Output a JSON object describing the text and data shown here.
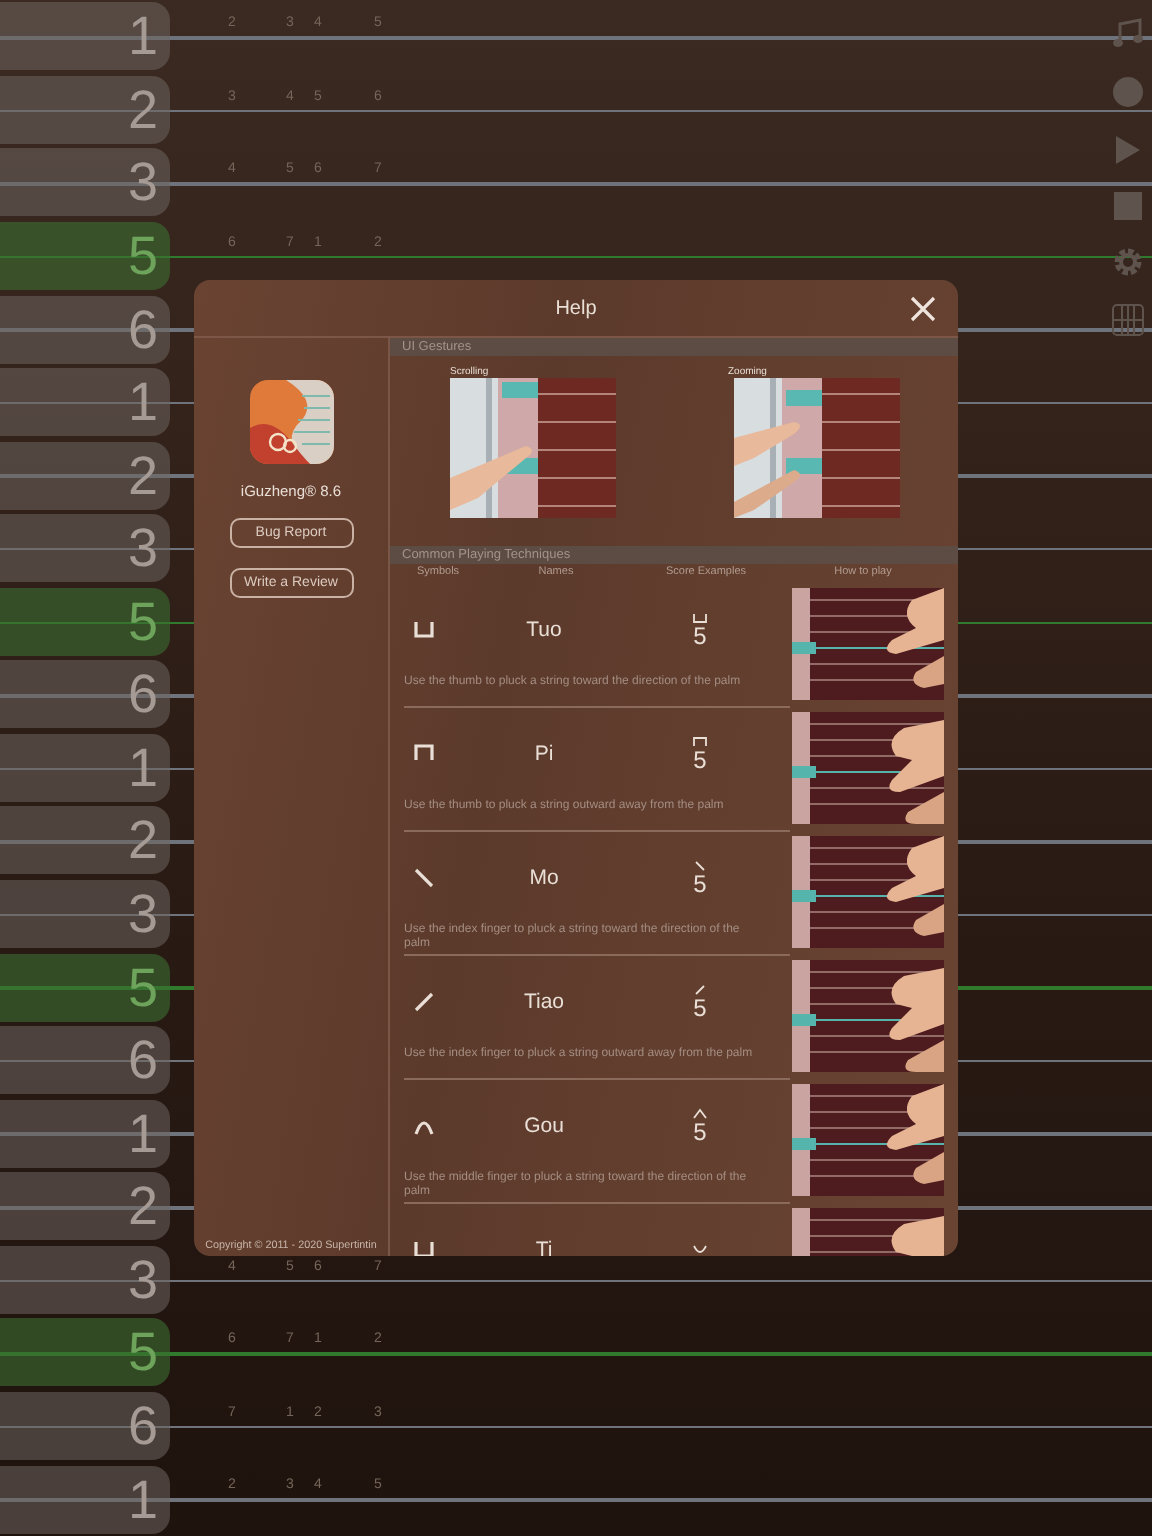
{
  "strings": [
    {
      "label": "1",
      "highlighted": false,
      "notes": [
        "2",
        "3",
        "4",
        "5"
      ]
    },
    {
      "label": "2",
      "highlighted": false,
      "notes": [
        "3",
        "4",
        "5",
        "6"
      ]
    },
    {
      "label": "3",
      "highlighted": false,
      "notes": [
        "4",
        "5",
        "6",
        "7"
      ]
    },
    {
      "label": "5",
      "highlighted": true,
      "notes": [
        "6",
        "7",
        "1",
        "2"
      ]
    },
    {
      "label": "6",
      "highlighted": false
    },
    {
      "label": "1",
      "highlighted": false
    },
    {
      "label": "2",
      "highlighted": false
    },
    {
      "label": "3",
      "highlighted": false
    },
    {
      "label": "5",
      "highlighted": true
    },
    {
      "label": "6",
      "highlighted": false
    },
    {
      "label": "1",
      "highlighted": false
    },
    {
      "label": "2",
      "highlighted": false
    },
    {
      "label": "3",
      "highlighted": false
    },
    {
      "label": "5",
      "highlighted": true
    },
    {
      "label": "6",
      "highlighted": false
    },
    {
      "label": "1",
      "highlighted": false
    },
    {
      "label": "2",
      "highlighted": false
    },
    {
      "label": "3",
      "highlighted": false,
      "notes": [
        "4",
        "5",
        "6",
        "7"
      ]
    },
    {
      "label": "5",
      "highlighted": true,
      "notes": [
        "6",
        "7",
        "1",
        "2"
      ]
    },
    {
      "label": "6",
      "highlighted": false,
      "notes": [
        "7",
        "1",
        "2",
        "3"
      ]
    },
    {
      "label": "1",
      "highlighted": false,
      "notes": [
        "2",
        "3",
        "4",
        "5"
      ]
    }
  ],
  "dialog": {
    "title": "Help",
    "app_name": "iGuzheng® 8.6",
    "buttons": [
      "Bug Report",
      "Write a Review"
    ],
    "copyright": "Copyright © 2011 - 2020 Supertintin",
    "gestures": {
      "heading": "UI Gestures",
      "captions": [
        "Scrolling",
        "Zooming"
      ]
    },
    "techniques": {
      "heading": "Common Playing Techniques",
      "columns": [
        "Symbols",
        "Names",
        "Score Examples",
        "How to play"
      ],
      "rows": [
        {
          "kind": "tuo",
          "name": "Tuo",
          "score": "5",
          "description": "Use the thumb to pluck a string toward the direction of the palm"
        },
        {
          "kind": "pi",
          "name": "Pi",
          "score": "5",
          "description": "Use the thumb to pluck a string outward away from the palm"
        },
        {
          "kind": "mo",
          "name": "Mo",
          "score": "5",
          "description": "Use the index finger to pluck a string toward the direction of the palm"
        },
        {
          "kind": "tiao",
          "name": "Tiao",
          "score": "5",
          "description": "Use the index finger to pluck a string outward away from the palm"
        },
        {
          "kind": "gou",
          "name": "Gou",
          "score": "5",
          "description": "Use the middle finger to pluck a string toward the direction of the palm"
        },
        {
          "kind": "ti",
          "name": "Ti"
        }
      ]
    }
  }
}
